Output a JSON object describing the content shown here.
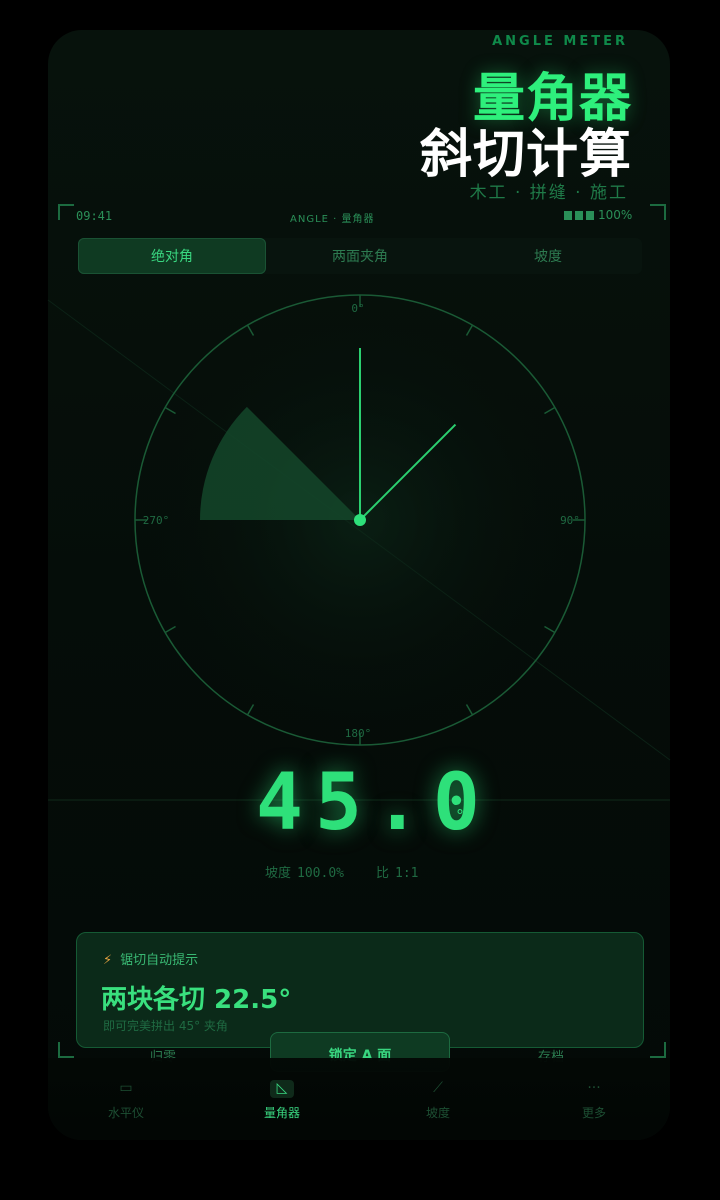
{
  "promo": {
    "subtitle": "ANGLE METER",
    "title_line1": "量角器",
    "title_line2": "斜切计算",
    "tags": "木工 · 拼缝 · 施工"
  },
  "status_bar": {
    "time": "09:41",
    "center": "ANGLE · 量角器",
    "battery": "100%"
  },
  "tabs": [
    {
      "label": "绝对角",
      "active": true
    },
    {
      "label": "两面夹角",
      "active": false
    },
    {
      "label": "坡度",
      "active": false
    }
  ],
  "dial": {
    "label_top": "0°",
    "label_right": "90°",
    "label_bottom": "180°",
    "label_left": "270°",
    "needle_angle_deg": 45
  },
  "readout": {
    "value": "45.0",
    "unit": "°",
    "slope_label": "坡度",
    "slope_value": "100.0%",
    "ratio_label": "比",
    "ratio_value": "1:1"
  },
  "hint_card": {
    "header": "锯切自动提示",
    "main": "两块各切 22.5°",
    "note": "即可完美拼出 45° 夹角"
  },
  "actions": {
    "left": "归零",
    "middle": "锁定 A 面",
    "right": "存档"
  },
  "nav": [
    {
      "label": "水平仪",
      "icon": "level-icon",
      "active": false
    },
    {
      "label": "量角器",
      "icon": "protractor-icon",
      "active": true
    },
    {
      "label": "坡度",
      "icon": "slope-icon",
      "active": false
    },
    {
      "label": "更多",
      "icon": "more-icon",
      "active": false
    }
  ],
  "colors": {
    "accent": "#2ee07a",
    "background": "#050d09",
    "card": "#0b2a19"
  }
}
